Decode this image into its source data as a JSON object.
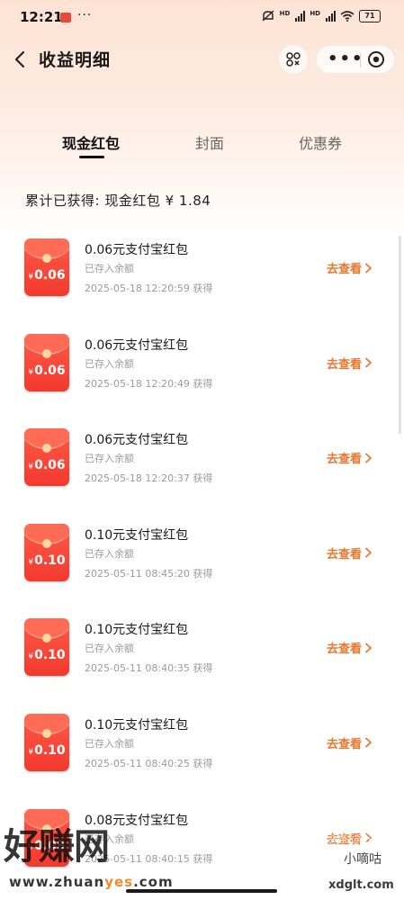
{
  "status_bar": {
    "time": "12:21",
    "dots": "···",
    "battery": "71",
    "icons": [
      "app-icon",
      "mute-icon",
      "hd-signal-icon",
      "hd-signal-icon",
      "wifi-icon",
      "battery-icon"
    ]
  },
  "header": {
    "title": "收益明细",
    "back_icon": "chevron-left-icon",
    "scan_icon": "scan-icon",
    "more_icon": "more-dots-icon",
    "close_icon": "target-close-icon"
  },
  "tabs": [
    {
      "label": "现金红包",
      "active": true
    },
    {
      "label": "封面",
      "active": false
    },
    {
      "label": "优惠券",
      "active": false
    }
  ],
  "summary": "累计已获得: 现金红包 ¥ 1.84",
  "colors": {
    "accent_orange": "#e8772e",
    "envelope_red": "#f23a2e",
    "header_gradient_top": "#fde3d4"
  },
  "items": [
    {
      "amount": "0.06",
      "currency": "¥",
      "title": "0.06元支付宝红包",
      "status": "已存入余额",
      "time": "2025-05-18 12:20:59 获得",
      "link": "去查看"
    },
    {
      "amount": "0.06",
      "currency": "¥",
      "title": "0.06元支付宝红包",
      "status": "已存入余额",
      "time": "2025-05-18 12:20:49 获得",
      "link": "去查看"
    },
    {
      "amount": "0.06",
      "currency": "¥",
      "title": "0.06元支付宝红包",
      "status": "已存入余额",
      "time": "2025-05-18 12:20:37 获得",
      "link": "去查看"
    },
    {
      "amount": "0.10",
      "currency": "¥",
      "title": "0.10元支付宝红包",
      "status": "已存入余额",
      "time": "2025-05-11 08:45:20 获得",
      "link": "去查看"
    },
    {
      "amount": "0.10",
      "currency": "¥",
      "title": "0.10元支付宝红包",
      "status": "已存入余额",
      "time": "2025-05-11 08:40:35 获得",
      "link": "去查看"
    },
    {
      "amount": "0.10",
      "currency": "¥",
      "title": "0.10元支付宝红包",
      "status": "已存入余额",
      "time": "2025-05-11 08:40:25 获得",
      "link": "去查看"
    },
    {
      "amount": "0.08",
      "currency": "¥",
      "title": "0.08元支付宝红包",
      "status": "已存入余额",
      "time": "2025-05-11 08:40:15 获得",
      "link": "去查看"
    }
  ],
  "watermark": {
    "left_big": "好赚网",
    "left_url_prefix": "www.zhuan",
    "left_url_highlight": "yes",
    "left_url_suffix": ".com",
    "right_faint": "头条 @小嘀咕",
    "right_logo": "小嘀咕",
    "right_domain": "xdglt.com"
  }
}
